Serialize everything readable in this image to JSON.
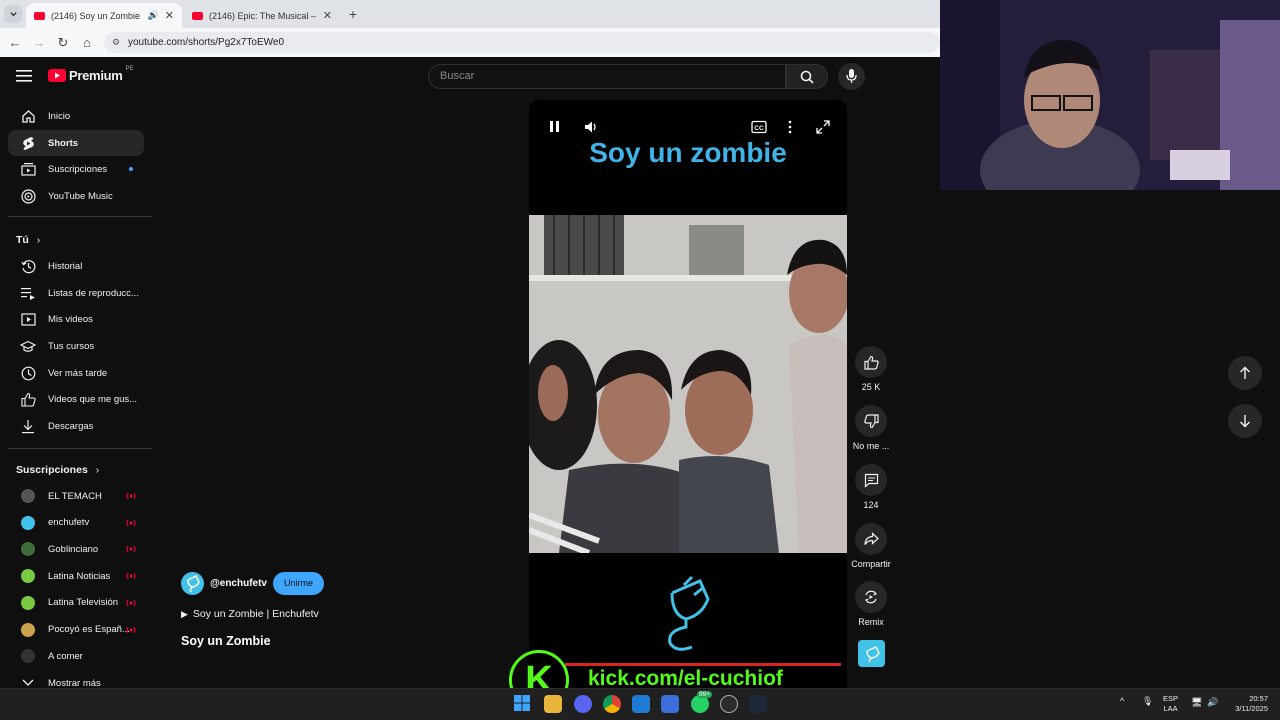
{
  "browser": {
    "tabs": [
      {
        "title": "(2146) Soy un Zombie - You"
      },
      {
        "title": "(2146) Epic: The Musical – La E"
      }
    ],
    "url": "youtube.com/shorts/Pg2x7ToEWe0"
  },
  "header": {
    "brand": "Premium",
    "country_badge": "PE",
    "search_placeholder": "Buscar"
  },
  "sidebar": {
    "main": [
      {
        "label": "Inicio",
        "icon": "home-icon"
      },
      {
        "label": "Shorts",
        "icon": "shorts-icon"
      },
      {
        "label": "Suscripciones",
        "icon": "subscriptions-icon"
      },
      {
        "label": "YouTube Music",
        "icon": "music-icon"
      }
    ],
    "you_heading": "Tú",
    "you": [
      {
        "label": "Historial",
        "icon": "history-icon"
      },
      {
        "label": "Listas de reproducc...",
        "icon": "playlists-icon"
      },
      {
        "label": "Mis videos",
        "icon": "my-videos-icon"
      },
      {
        "label": "Tus cursos",
        "icon": "courses-icon"
      },
      {
        "label": "Ver más tarde",
        "icon": "watch-later-icon"
      },
      {
        "label": "Videos que me gus...",
        "icon": "liked-icon"
      },
      {
        "label": "Descargas",
        "icon": "downloads-icon"
      }
    ],
    "subs_heading": "Suscripciones",
    "subs": [
      {
        "label": "EL TEMACH",
        "color": "#555555"
      },
      {
        "label": "enchufetv",
        "color": "#41c2e8"
      },
      {
        "label": "Goblinciano",
        "color": "#3f6b3a"
      },
      {
        "label": "Latina Noticias",
        "color": "#7ac943"
      },
      {
        "label": "Latina Televisión",
        "color": "#7ac943"
      },
      {
        "label": "Pocoyó es Españ...",
        "color": "#c9a24b"
      },
      {
        "label": "A comer",
        "color": "#333333"
      }
    ],
    "show_more": "Mostrar más"
  },
  "player": {
    "overlay_title": "Soy un zombie",
    "accent": "#3fb4e6"
  },
  "actions": {
    "likes": "25 K",
    "dislike": "No me ...",
    "comments": "124",
    "share": "Compartir",
    "remix": "Remix"
  },
  "channel": {
    "handle": "@enchufetv",
    "join": "Unirme",
    "playlist": "Soy un Zombie | Enchufetv",
    "short_title": "Soy un Zombie"
  },
  "overlay": {
    "kick_letter": "K",
    "kick_url": "kick.com/el-cuchiof"
  },
  "taskbar": {
    "lang1": "ESP",
    "lang2": "LAA",
    "time": "20:57",
    "date": "3/11/2025",
    "badge": "99+"
  }
}
